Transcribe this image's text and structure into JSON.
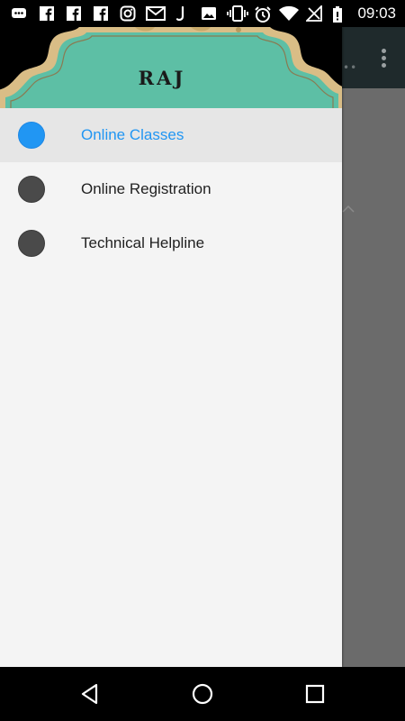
{
  "status_bar": {
    "time": "09:03",
    "icons": [
      "message-icon",
      "facebook-icon",
      "facebook-icon",
      "facebook-icon",
      "instagram-icon",
      "gmail-icon",
      "j-app-icon",
      "image-icon",
      "vibrate-icon",
      "alarm-icon",
      "wifi-icon",
      "no-signal-icon",
      "battery-icon"
    ]
  },
  "drawer": {
    "header": {
      "logo_text": "RAJ"
    },
    "items": [
      {
        "label": "Online Classes",
        "selected": true,
        "icon": "circle-icon",
        "icon_color": "#2196f3"
      },
      {
        "label": "Online Registration",
        "selected": false,
        "icon": "circle-icon",
        "icon_color": "#4a4a4a"
      },
      {
        "label": "Technical Helpline",
        "selected": false,
        "icon": "circle-icon",
        "icon_color": "#4a4a4a"
      }
    ]
  },
  "colors": {
    "accent": "#2196f3",
    "drawer_bg": "#f4f4f4",
    "selected_bg": "#e6e6e6",
    "scrim": "#6b6b6b"
  },
  "nav_bar": {
    "buttons": [
      "back-icon",
      "home-icon",
      "recents-icon"
    ]
  }
}
